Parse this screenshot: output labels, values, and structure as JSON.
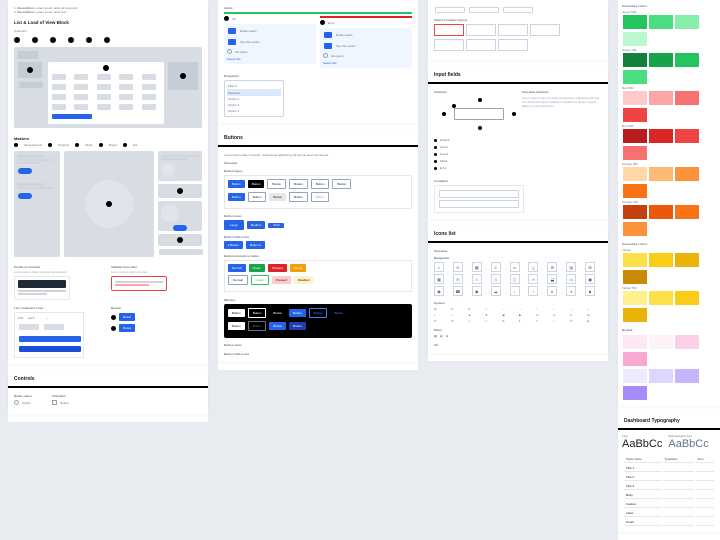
{
  "col1": {
    "section1": {
      "title": "List & Load of View Block",
      "sub": "Overview"
    },
    "steps": [
      "1",
      "2",
      "3",
      "4",
      "5",
      "6"
    ],
    "overview_num": [
      "1",
      "2",
      "3"
    ],
    "master": {
      "title": "Masters",
      "tabs": [
        "All spaces list",
        "Projects",
        "Tasks",
        "Board",
        "List",
        "Calendar"
      ]
    },
    "forms": {
      "t1": "Profile on channel",
      "t2": "Validate form data",
      "t3": "List containers inner",
      "t4": "Banner"
    },
    "controls": {
      "title": "Controls",
      "s1": "Radio select",
      "s2": "Checkbox"
    }
  },
  "col2": {
    "alerts": {
      "title": "Alerts",
      "ok": "Ok",
      "error": "Error",
      "radio1": "Radio select",
      "radio2": "Use this option",
      "radio3": "Another",
      "link": "Select link"
    },
    "dropdown": {
      "title": "Dropdown"
    },
    "buttons": {
      "title": "Buttons",
      "sub": "Overview",
      "types_label": "Button types",
      "types": [
        "Button",
        "Button",
        "Button",
        "Button",
        "Button",
        "Button",
        "Button",
        "Button",
        "Button",
        "Button",
        "Button"
      ],
      "sizes_label": "Button sizes",
      "sizes": [
        "Large",
        "Medium",
        "Small"
      ],
      "icons_label": "Button with icons",
      "icons": [
        "Button",
        "Button"
      ],
      "states_label": "Button interactive states",
      "states": [
        "Normal",
        "Hover",
        "Pressed",
        "Focus",
        "Disabled"
      ],
      "dark_label": "Masters",
      "darks": [
        "Button",
        "Button",
        "Button",
        "Button",
        "Button",
        "Button",
        "Button",
        "Button",
        "Button",
        "Button"
      ],
      "dsizes_label": "Button sizes",
      "dicons_label": "Button with icons"
    }
  },
  "col3": {
    "content": {
      "title": "",
      "l1": "Select container layout"
    },
    "input": {
      "title": "Input fields",
      "anat": "Anatomy",
      "inst": "Overview behavior",
      "states": [
        "Default",
        "Hover",
        "Focus",
        "Filled",
        "Error",
        "Disabled"
      ],
      "cont": "Container"
    },
    "icons": {
      "title": "Icons list",
      "sub": "Overview",
      "nav": "Navigation",
      "sys": "System",
      "other": "Other"
    }
  },
  "col4": {
    "colors": {
      "title": "Secondary colors",
      "groups": [
        {
          "name": "Green 500",
          "vals": [
            "#22c55e",
            "#4ade80",
            "#86efac",
            "#bbf7d0"
          ]
        },
        {
          "name": "Green 700",
          "vals": [
            "#15803d",
            "#16a34a",
            "#22c55e",
            "#4ade80"
          ]
        },
        {
          "name": "Red 500",
          "vals": [
            "#fecaca",
            "#fca5a5",
            "#f87171",
            "#ef4444"
          ]
        },
        {
          "name": "Red 700",
          "vals": [
            "#b91c1c",
            "#dc2626",
            "#ef4444",
            "#f87171"
          ]
        },
        {
          "name": "Orange 500",
          "vals": [
            "#fed7aa",
            "#fdba74",
            "#fb923c",
            "#f97316"
          ]
        },
        {
          "name": "Orange 700",
          "vals": [
            "#c2410c",
            "#ea580c",
            "#f97316",
            "#fb923c"
          ]
        }
      ],
      "sec2": "Secondary colors",
      "groups2": [
        {
          "name": "Yellow",
          "vals": [
            "#fde047",
            "#facc15",
            "#eab308",
            "#ca8a04"
          ]
        },
        {
          "name": "Yellow 700",
          "vals": [
            "#fef08a",
            "#fde047",
            "#facc15",
            "#eab308"
          ]
        }
      ],
      "neutral": "Neutral",
      "neutrals": [
        "#fce7f3",
        "#fdf2f8",
        "#fbcfe8",
        "#f9a8d4"
      ],
      "purple": [
        "#ede9fe",
        "#ddd6fe",
        "#c4b5fd",
        "#a78bfa"
      ]
    },
    "typo": {
      "title": "Dashboard Typography",
      "sample": "AaBbCc",
      "sample2": "AaBbCc",
      "l1": "Inter",
      "l2": "Monospaced Jost",
      "cols": [
        "Style name",
        "Typeface",
        "Size"
      ],
      "rows": [
        "Title 1",
        "Title 2",
        "Title 3",
        "Body",
        "Caption",
        "Label",
        "Small"
      ]
    }
  }
}
